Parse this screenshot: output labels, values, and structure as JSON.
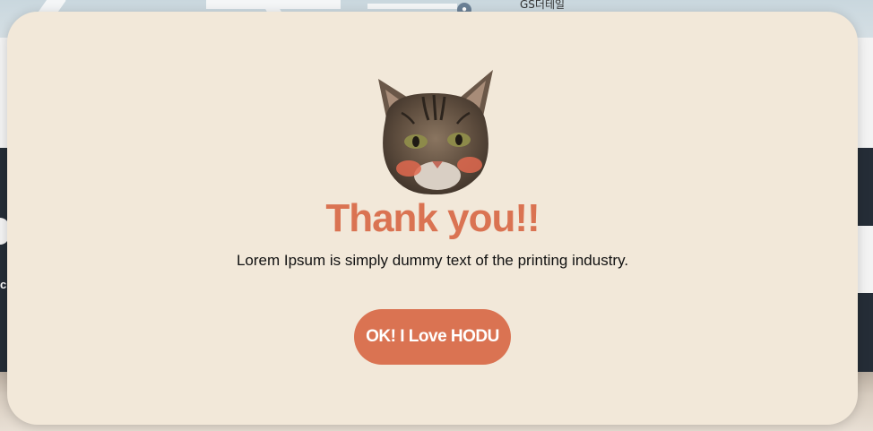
{
  "background": {
    "map_label": "GS더테일",
    "left_text": "c"
  },
  "modal": {
    "icon": "cat-face-icon",
    "title": "Thank you!!",
    "description": "Lorem Ipsum is simply dummy text of the printing industry.",
    "ok_button_label": "OK! I Love HODU"
  },
  "colors": {
    "modal_background": "#f2e8d9",
    "accent": "#da7352",
    "button_text": "#ffffff",
    "body_text": "#111111"
  }
}
